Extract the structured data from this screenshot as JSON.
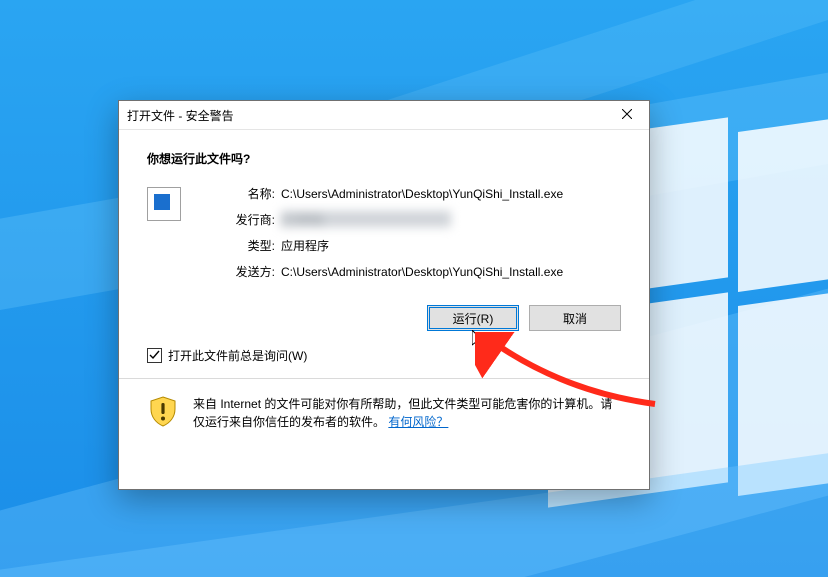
{
  "window": {
    "title": "打开文件 - 安全警告"
  },
  "prompt": "你想运行此文件吗?",
  "info": {
    "name_label": "名称:",
    "name_value": "C:\\Users\\Administrator\\Desktop\\YunQiShi_Install.exe",
    "publisher_label": "发行商:",
    "publisher_value": "[已模糊]",
    "type_label": "类型:",
    "type_value": "应用程序",
    "from_label": "发送方:",
    "from_value": "C:\\Users\\Administrator\\Desktop\\YunQiShi_Install.exe"
  },
  "buttons": {
    "run": "运行(R)",
    "cancel": "取消"
  },
  "checkbox": {
    "checked": true,
    "label": "打开此文件前总是询问(W)"
  },
  "footer": {
    "text_before": "来自 Internet 的文件可能对你有所帮助，但此文件类型可能危害你的计算机。请仅运行来自你信任的发布者的软件。",
    "link_text": "有何风险？"
  }
}
